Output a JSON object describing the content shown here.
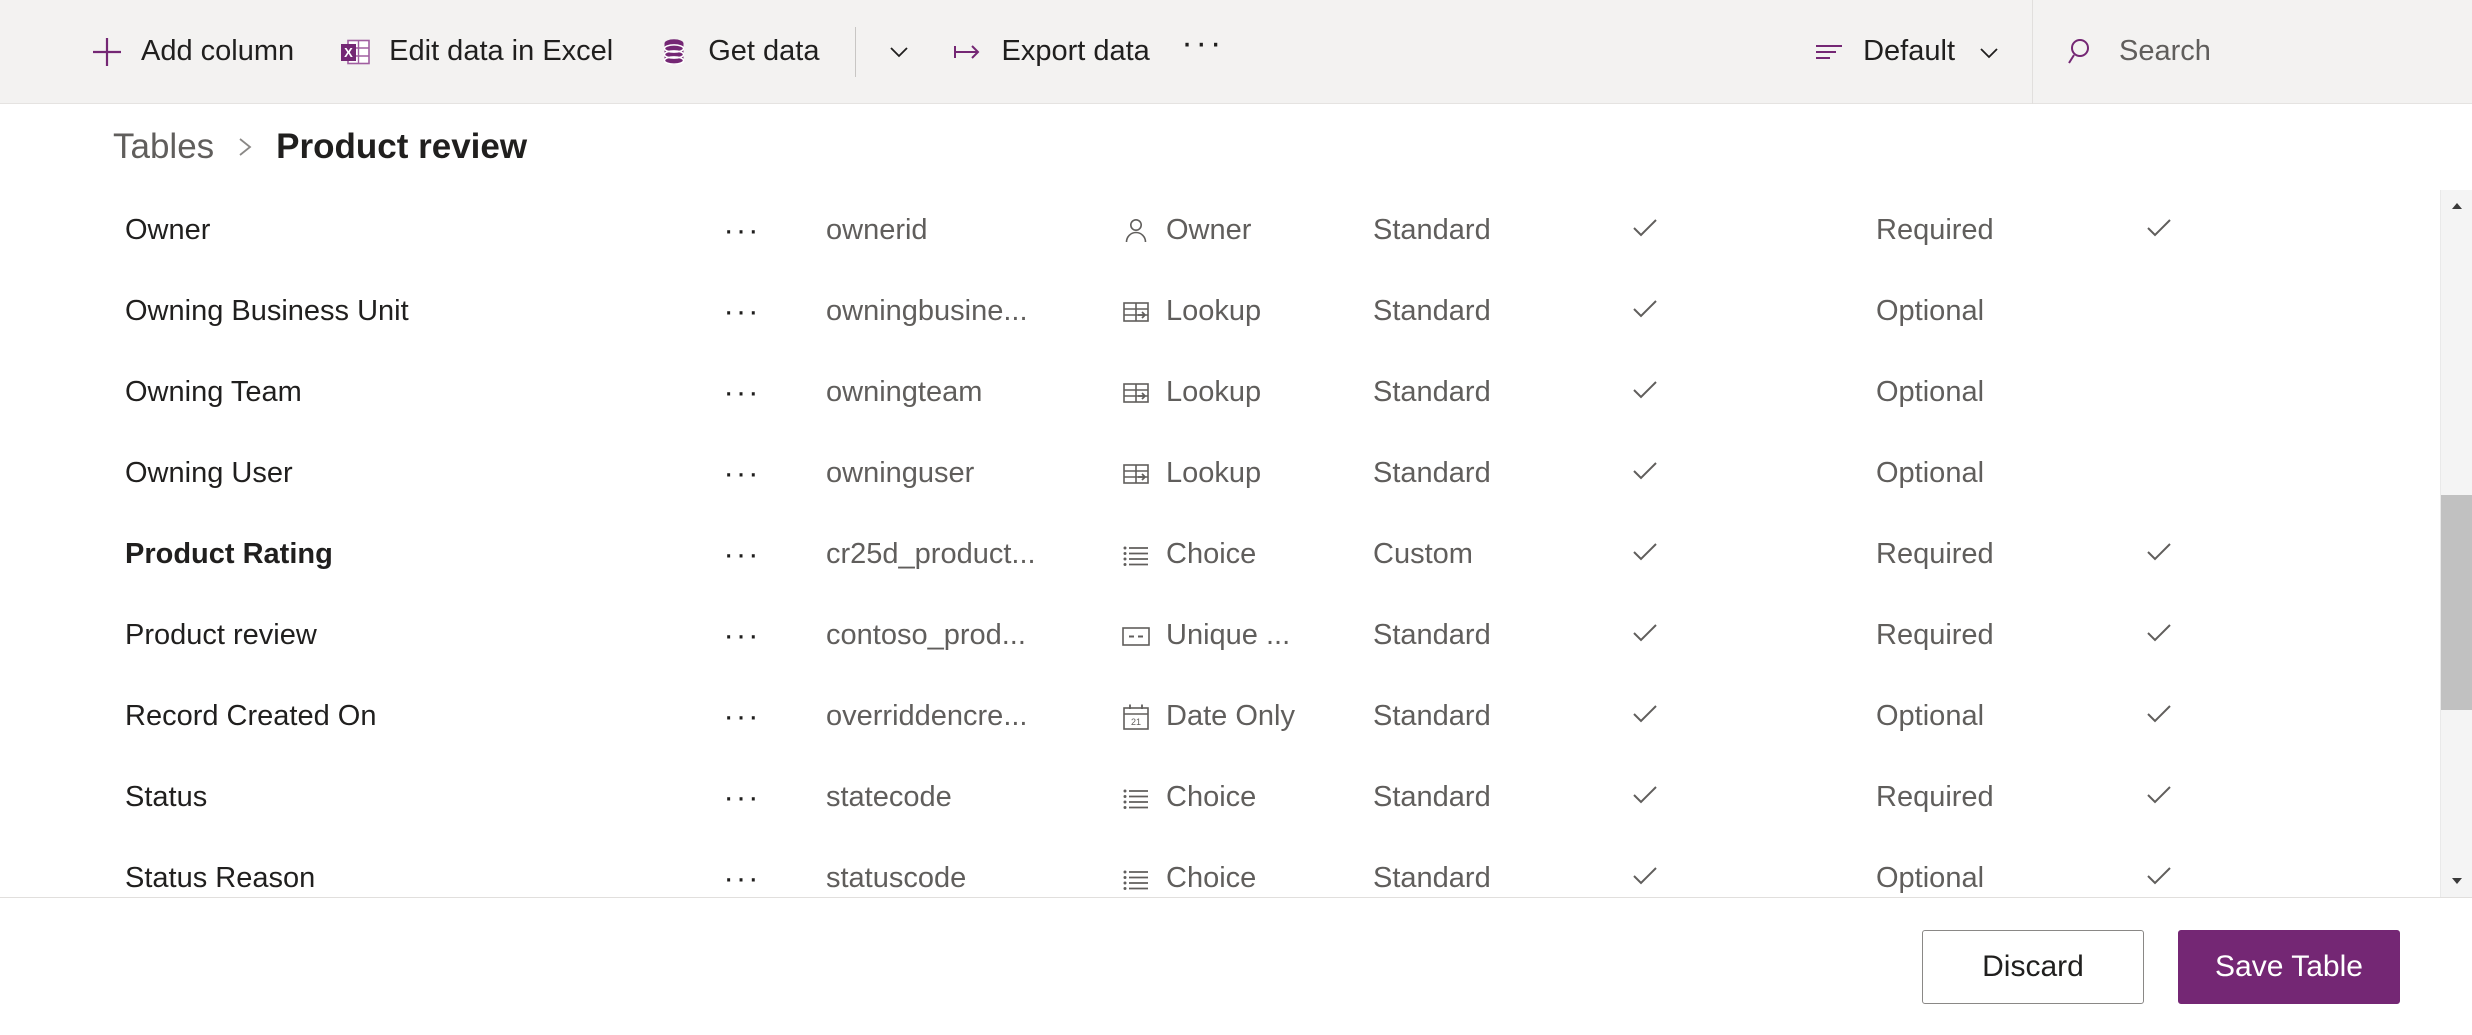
{
  "colors": {
    "brand_purple": "#742774",
    "toolbar_bg": "#f3f2f1",
    "text_primary": "#201f1e",
    "text_secondary": "#605e5c"
  },
  "toolbar": {
    "add_column": "Add column",
    "edit_in_excel": "Edit data in Excel",
    "get_data": "Get data",
    "export_data": "Export data",
    "overflow": "···",
    "view_label": "Default",
    "search_placeholder": "Search"
  },
  "breadcrumb": {
    "parent": "Tables",
    "separator": "›",
    "current": "Product review"
  },
  "grid": {
    "rows": [
      {
        "display_name": "Owner",
        "bold": false,
        "menu": "···",
        "logical_name": "ownerid",
        "data_type": "Owner",
        "type_icon": "person-icon",
        "customization": "Standard",
        "searchable": "✓",
        "requirement": "Required",
        "flag": "✓"
      },
      {
        "display_name": "Owning Business Unit",
        "bold": false,
        "menu": "···",
        "logical_name": "owningbusine...",
        "data_type": "Lookup",
        "type_icon": "lookup-icon",
        "customization": "Standard",
        "searchable": "✓",
        "requirement": "Optional",
        "flag": ""
      },
      {
        "display_name": "Owning Team",
        "bold": false,
        "menu": "···",
        "logical_name": "owningteam",
        "data_type": "Lookup",
        "type_icon": "lookup-icon",
        "customization": "Standard",
        "searchable": "✓",
        "requirement": "Optional",
        "flag": ""
      },
      {
        "display_name": "Owning User",
        "bold": false,
        "menu": "···",
        "logical_name": "owninguser",
        "data_type": "Lookup",
        "type_icon": "lookup-icon",
        "customization": "Standard",
        "searchable": "✓",
        "requirement": "Optional",
        "flag": ""
      },
      {
        "display_name": "Product Rating",
        "bold": true,
        "menu": "···",
        "logical_name": "cr25d_product...",
        "data_type": "Choice",
        "type_icon": "choice-icon",
        "customization": "Custom",
        "searchable": "✓",
        "requirement": "Required",
        "flag": "✓"
      },
      {
        "display_name": "Product review",
        "bold": false,
        "menu": "···",
        "logical_name": "contoso_prod...",
        "data_type": "Unique ...",
        "type_icon": "unique-identifier-icon",
        "customization": "Standard",
        "searchable": "✓",
        "requirement": "Required",
        "flag": "✓"
      },
      {
        "display_name": "Record Created On",
        "bold": false,
        "menu": "···",
        "logical_name": "overriddencre...",
        "data_type": "Date Only",
        "type_icon": "calendar-icon",
        "customization": "Standard",
        "searchable": "✓",
        "requirement": "Optional",
        "flag": "✓"
      },
      {
        "display_name": "Status",
        "bold": false,
        "menu": "···",
        "logical_name": "statecode",
        "data_type": "Choice",
        "type_icon": "choice-icon",
        "customization": "Standard",
        "searchable": "✓",
        "requirement": "Required",
        "flag": "✓"
      },
      {
        "display_name": "Status Reason",
        "bold": false,
        "menu": "···",
        "logical_name": "statuscode",
        "data_type": "Choice",
        "type_icon": "choice-icon",
        "customization": "Standard",
        "searchable": "✓",
        "requirement": "Optional",
        "flag": "✓"
      }
    ]
  },
  "footer": {
    "discard": "Discard",
    "save": "Save Table"
  }
}
